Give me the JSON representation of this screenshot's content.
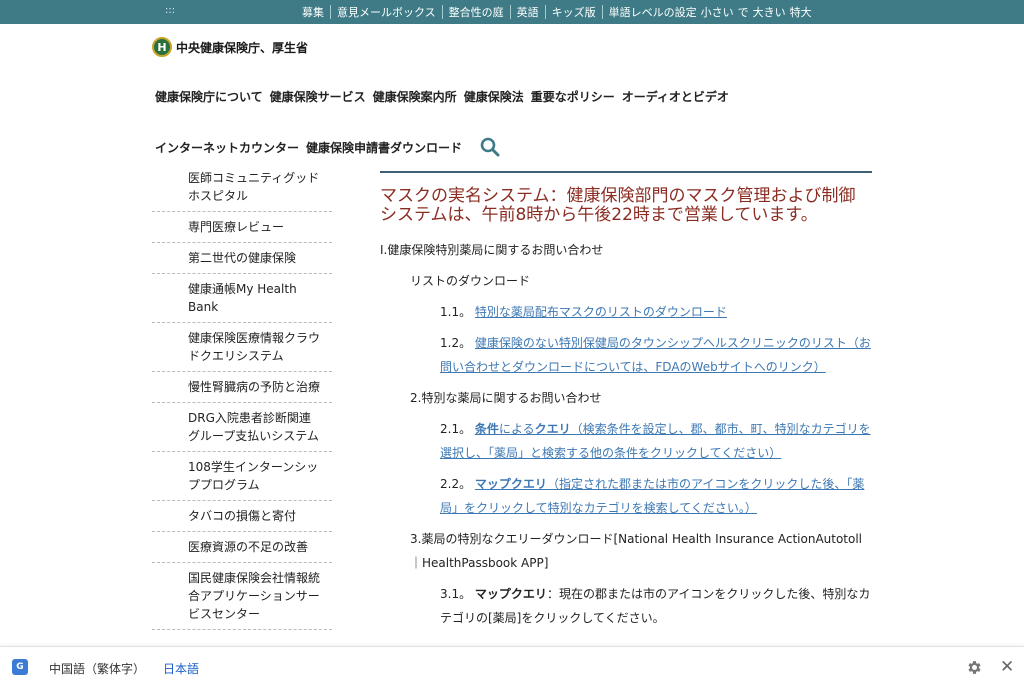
{
  "topbar": {
    "dots": ":::",
    "links": [
      "募集",
      "意見メールボックス",
      "整合性の庭",
      "英語",
      "キッズ版"
    ],
    "size_label": "単語レベルの設定",
    "sizes": [
      "小さい",
      "で",
      "大きい",
      "特大"
    ]
  },
  "logo": {
    "emblem": "H",
    "name": "中央健康保険庁、厚生省"
  },
  "nav_primary": [
    "健康保険庁について",
    "健康保険サービス",
    "健康保険案内所",
    "健康保険法",
    "重要なポリシー",
    "オーディオとビデオ"
  ],
  "nav_secondary": [
    "インターネットカウンター",
    "健康保険申請書ダウンロード"
  ],
  "icons": {
    "search": "search-icon",
    "settings": "gear-icon",
    "close": "close-icon",
    "translate": "translate-icon"
  },
  "sidebar": [
    "医師コミュニティグッドホスピタル",
    "専門医療レビュー",
    "第二世代の健康保険",
    "健康通帳My Health Bank",
    "健康保険医療情報クラウドクエリシステム",
    "慢性腎臓病の予防と治療",
    "DRG入院患者診断関連グループ支払いシステム",
    "108学生インターンシッププログラム",
    "タバコの損傷と寄付",
    "医療資源の不足の改善",
    "国民健康保険会社情報統合アプリケーションサービスセンター"
  ],
  "content": {
    "headline": "マスクの実名システム：健康保険部門のマスク管理および制御システムは、午前8時から午後22時まで営業しています。",
    "section1": "I.健康保険特別薬局に関するお問い合わせ",
    "list_download": "リストのダウンロード",
    "item_1_1_num": "1.1。",
    "item_1_1_link": "特別な薬局配布マスクのリストのダウンロード",
    "item_1_2_num": "1.2。",
    "item_1_2_link": "健康保険のない特別保健局のタウンシップヘルスクリニックのリスト（お問い合わせとダウンロードについては、FDAのWebサイトへのリンク）",
    "section2": "2.特別な薬局に関するお問い合わせ",
    "item_2_1_num": "2.1。",
    "item_2_1_bold1": "条件",
    "item_2_1_mid": "による",
    "item_2_1_bold2": "クエリ",
    "item_2_1_rest": "（検索条件を設定し、郡、都市、町、特別なカテゴリを選択し、「薬局」と検索する他の条件をクリックしてください）",
    "item_2_2_num": "2.2。",
    "item_2_2_bold": "マップクエリ",
    "item_2_2_rest": "（指定された郡または市のアイコンをクリックした後、「薬局」をクリックして特別なカテゴリを検索してください。）",
    "section3": "3.薬局の特別なクエリーダウンロード[National Health Insurance ActionAutotoll｜HealthPassbook APP]",
    "item_3_1_num": "3.1。",
    "item_3_1_bold": "マップクエリ",
    "item_3_1_rest": "：現在の郡または市のアイコンをクリックした後、特別なカテゴリの[薬局]をクリックしてください。"
  },
  "bottombar": {
    "gt_letter": "G",
    "lang_traditional": "中国語（繁体字）",
    "lang_japanese": "日本語",
    "close_glyph": "✕"
  },
  "colors": {
    "topbar": "#3e7b86",
    "headline": "#8b2c22",
    "link": "#3d78b3",
    "active_lang": "#1a5fc7"
  }
}
